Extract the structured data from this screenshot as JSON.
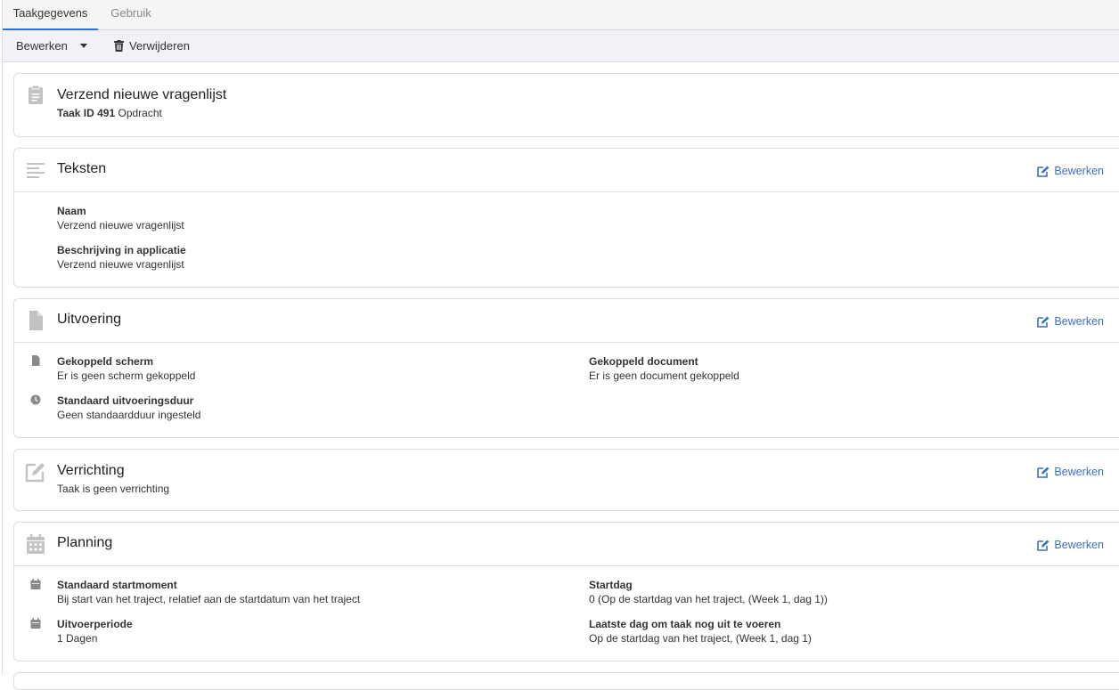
{
  "tabs": [
    {
      "label": "Taakgegevens",
      "active": true
    },
    {
      "label": "Gebruik",
      "active": false
    }
  ],
  "toolbar": {
    "edit_label": "Bewerken",
    "delete_label": "Verwijderen"
  },
  "task": {
    "title": "Verzend nieuwe vragenlijst",
    "id_label": "Taak ID 491",
    "type": "Opdracht",
    "icon": "clipboard-icon"
  },
  "edit_link_label": "Bewerken",
  "sections": {
    "teksten": {
      "title": "Teksten",
      "icon": "text-lines-icon",
      "fields": [
        {
          "label": "Naam",
          "value": "Verzend nieuwe vragenlijst"
        },
        {
          "label": "Beschrijving in applicatie",
          "value": "Verzend nieuwe vragenlijst"
        }
      ]
    },
    "uitvoering": {
      "title": "Uitvoering",
      "icon": "document-icon",
      "fields": [
        {
          "label": "Gekoppeld scherm",
          "value": "Er is geen scherm gekoppeld",
          "icon": "file-icon"
        },
        {
          "label": "Gekoppeld document",
          "value": "Er is geen document gekoppeld"
        },
        {
          "label": "Standaard uitvoeringsduur",
          "value": "Geen standaardduur ingesteld",
          "icon": "clock-icon"
        }
      ]
    },
    "verrichting": {
      "title": "Verrichting",
      "icon": "pencil-square-icon",
      "value": "Taak is geen verrichting"
    },
    "planning": {
      "title": "Planning",
      "icon": "calendar-icon",
      "fields": [
        {
          "label": "Standaard startmoment",
          "value": "Bij start van het traject, relatief aan de startdatum van het traject",
          "icon": "calendar-small-icon"
        },
        {
          "label": "Startdag",
          "value": "0 (Op de startdag van het traject, (Week 1, dag 1))"
        },
        {
          "label": "Uitvoerperiode",
          "value": "1 Dagen",
          "icon": "calendar-small-icon"
        },
        {
          "label": "Laatste dag om taak nog uit te voeren",
          "value": "Op de startdag van het traject, (Week 1, dag 1)"
        }
      ]
    }
  },
  "colors": {
    "accent": "#2f6fd1",
    "link": "#3d6fc1",
    "icon_gray": "#bdbdbd"
  }
}
